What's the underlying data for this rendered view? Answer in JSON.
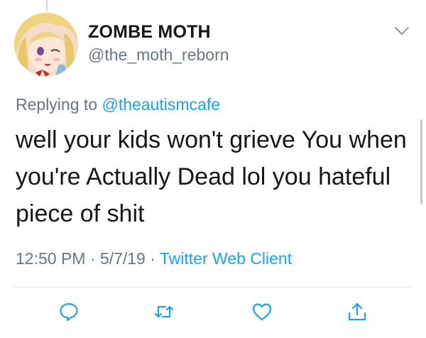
{
  "tweet": {
    "author": {
      "display_name": "ZOMBE MOTH",
      "handle": "@the_moth_reborn"
    },
    "reply_context": {
      "prefix": "Replying to",
      "mention": "@theautismcafe"
    },
    "text": "well your kids won't grieve You when you're Actually Dead lol you hateful piece of shit",
    "meta": {
      "time": "12:50 PM",
      "separator": "·",
      "date": "5/7/19",
      "client": "Twitter Web Client"
    }
  },
  "icons": {
    "more": "chevron-down-icon",
    "reply": "reply-icon",
    "retweet": "retweet-icon",
    "like": "like-icon",
    "share": "share-icon"
  },
  "colors": {
    "link": "#1da1f2",
    "secondary_text": "#657786",
    "primary_text": "#14171a",
    "icon": "#1da1f2"
  }
}
